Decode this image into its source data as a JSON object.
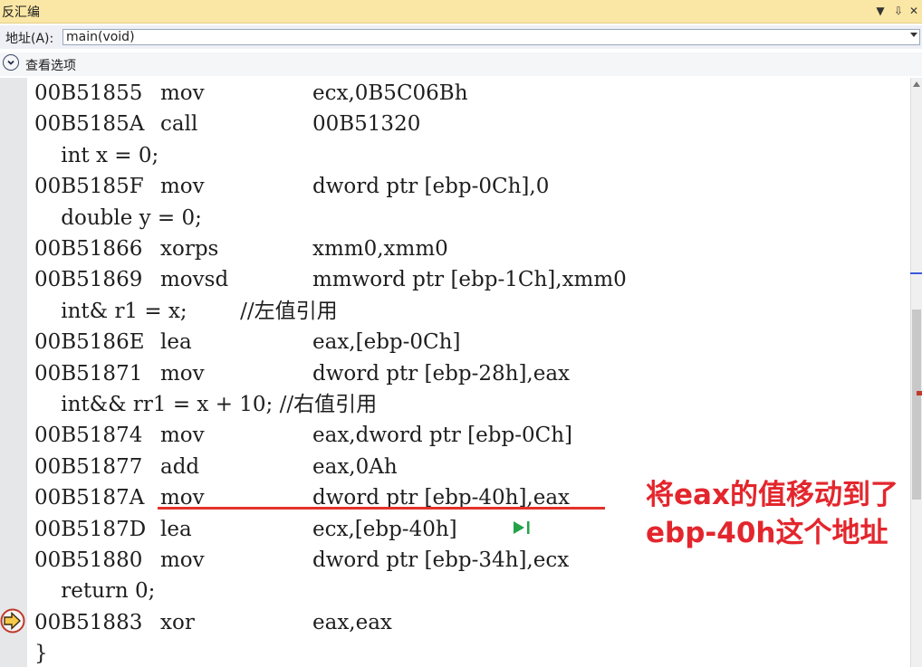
{
  "window": {
    "title": "反汇编",
    "controls": [
      "▼",
      "⇩",
      "✕"
    ]
  },
  "address_bar": {
    "label": "地址(A):",
    "value": "main(void)"
  },
  "view_options": {
    "label": "查看选项"
  },
  "code_lines": [
    {
      "addr": "00B51855",
      "op": "mov",
      "arg": "ecx,0B5C06Bh"
    },
    {
      "addr": "00B5185A",
      "op": "call",
      "arg": "00B51320"
    },
    {
      "src": "    int x = 0;"
    },
    {
      "addr": "00B5185F",
      "op": "mov",
      "arg": "dword ptr [ebp-0Ch],0"
    },
    {
      "src": "    double y = 0;"
    },
    {
      "addr": "00B51866",
      "op": "xorps",
      "arg": "xmm0,xmm0"
    },
    {
      "addr": "00B51869",
      "op": "movsd",
      "arg": "mmword ptr [ebp-1Ch],xmm0"
    },
    {
      "src": "    int& r1 = x;        //左值引用"
    },
    {
      "addr": "00B5186E",
      "op": "lea",
      "arg": "eax,[ebp-0Ch]"
    },
    {
      "addr": "00B51871",
      "op": "mov",
      "arg": "dword ptr [ebp-28h],eax"
    },
    {
      "src": "    int&& rr1 = x + 10; //右值引用"
    },
    {
      "addr": "00B51874",
      "op": "mov",
      "arg": "eax,dword ptr [ebp-0Ch]"
    },
    {
      "addr": "00B51877",
      "op": "add",
      "arg": "eax,0Ah"
    },
    {
      "addr": "00B5187A",
      "op": "mov",
      "arg": "dword ptr [ebp-40h],eax"
    },
    {
      "addr": "00B5187D",
      "op": "lea",
      "arg": "ecx,[ebp-40h]"
    },
    {
      "addr": "00B51880",
      "op": "mov",
      "arg": "dword ptr [ebp-34h],ecx"
    },
    {
      "src": "    return 0;"
    },
    {
      "addr": "00B51883",
      "op": "xor",
      "arg": "eax,eax"
    },
    {
      "src": "}"
    }
  ],
  "annotation": {
    "line1": "将eax的值移动到了",
    "line2": "ebp-40h这个地址",
    "color": "#e3262d"
  },
  "icons": {
    "view_options": "chevron-down-circle-icon",
    "run_to_cursor": "run-to-cursor-icon",
    "current_instruction": "current-instruction-arrow-icon"
  },
  "colors": {
    "title_bar": "#fbe7a5",
    "gutter": "#e6e7e8",
    "run_arrow": "#22a34a",
    "current_arrow_fill": "#f7c948",
    "current_arrow_border": "#c0392b"
  }
}
